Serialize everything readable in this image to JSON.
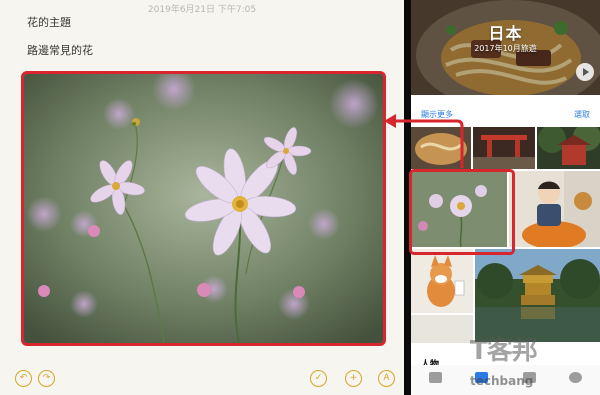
{
  "notes": {
    "timestamp": "2019年6月21日 下午7:05",
    "line1": "花的主題",
    "line2": "路邊常見的花",
    "toolbar": {
      "undo_icon": "undo-icon",
      "redo_icon": "redo-icon",
      "checklist_icon": "checkmark-circle-icon",
      "add_icon": "plus-circle-icon",
      "markup_icon": "pen-circle-icon"
    }
  },
  "photos": {
    "memory_title": "日本",
    "memory_subtitle": "2017年10月旅遊",
    "show_more": "顯示更多",
    "select": "選取",
    "people_label": "人物"
  },
  "watermark": {
    "text": "T客邦",
    "sub": "techbang"
  },
  "colors": {
    "highlight_red": "#d8262e",
    "notes_accent": "#d7a62a",
    "link_blue": "#2a7be4"
  }
}
